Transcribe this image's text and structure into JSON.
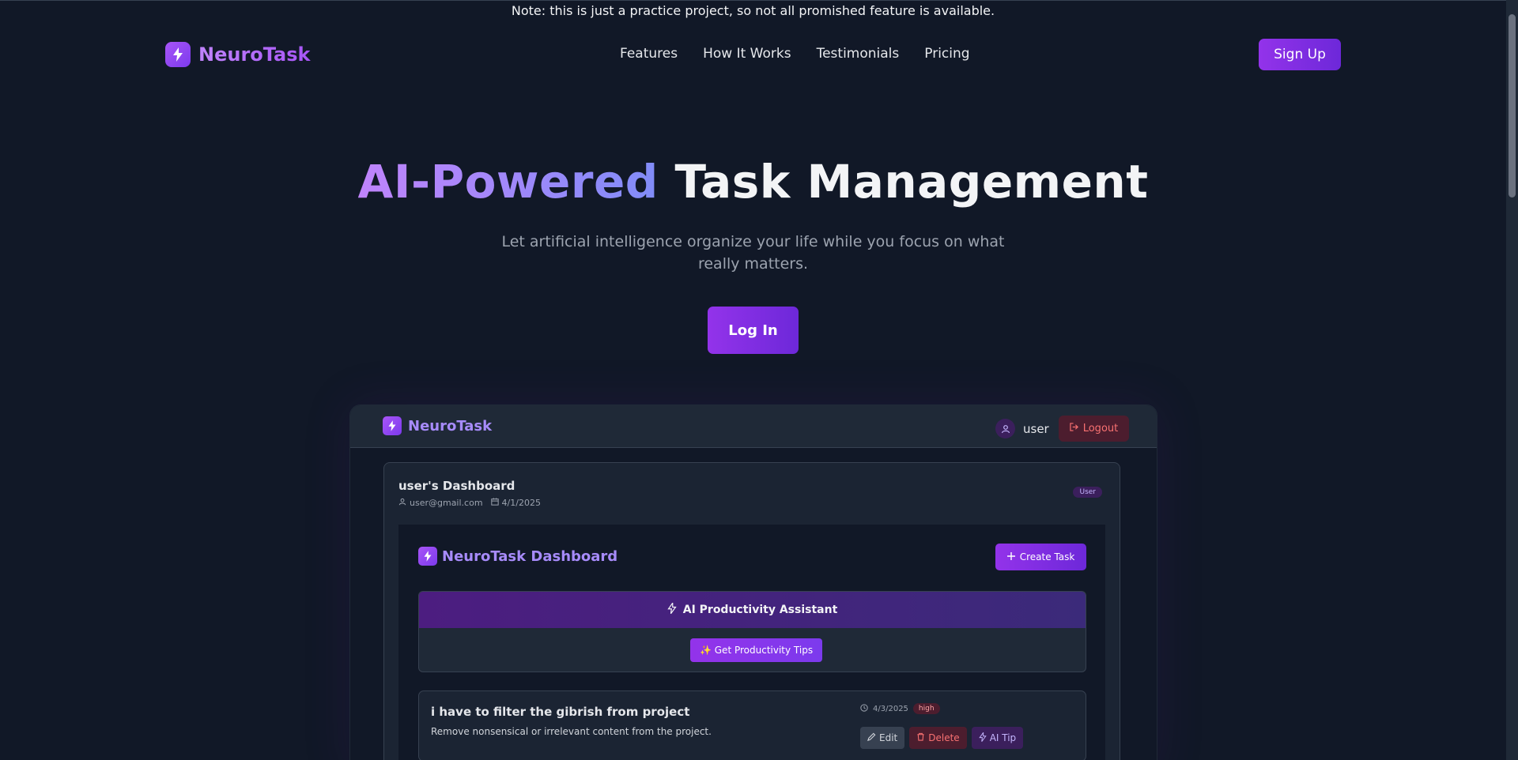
{
  "notice": "Note: this is just a practice project, so not all promished feature is available.",
  "brand": {
    "name": "NeuroTask",
    "logo_icon": "lightning-icon"
  },
  "nav": {
    "links": [
      "Features",
      "How It Works",
      "Testimonials",
      "Pricing"
    ],
    "signup_label": "Sign Up"
  },
  "hero": {
    "title_highlight": "AI-Powered",
    "title_rest": " Task Management",
    "subtitle": "Let artificial intelligence organize your life while you focus on what really matters.",
    "login_label": "Log In"
  },
  "preview": {
    "brand": "NeuroTask",
    "username": "user",
    "logout_label": "Logout",
    "dashboard_title": "user's Dashboard",
    "email": "user@gmail.com",
    "date": "4/1/2025",
    "role_badge": "User",
    "inner_title": "NeuroTask Dashboard",
    "create_label": "Create Task",
    "assistant_title": "AI Productivity Assistant",
    "tips_label": "✨ Get Productivity Tips",
    "task": {
      "title": "i have to filter the gibrish from project",
      "description": "Remove nonsensical or irrelevant content from the project.",
      "date": "4/3/2025",
      "priority": "high",
      "edit_label": "Edit",
      "delete_label": "Delete",
      "ai_label": "AI Tip"
    }
  },
  "colors": {
    "background": "#111827",
    "accent": "#9333ea",
    "accent_secondary": "#6d28d9"
  }
}
